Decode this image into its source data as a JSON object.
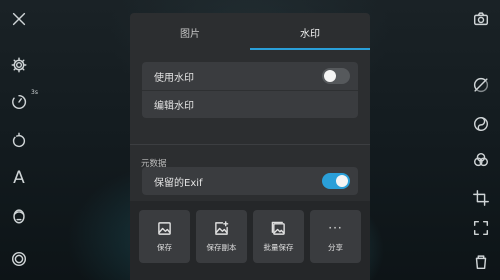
{
  "left_toolbar": {
    "items": [
      {
        "icon": "close-icon"
      },
      {
        "icon": "gear-icon"
      },
      {
        "icon": "timer-icon",
        "badge": "3s"
      },
      {
        "icon": "rotate-icon"
      },
      {
        "icon": "text-icon",
        "glyph": "A"
      },
      {
        "icon": "face-icon"
      },
      {
        "icon": "shutter-icon"
      }
    ]
  },
  "right_toolbar": {
    "items": [
      {
        "icon": "camera-icon"
      },
      {
        "icon": "filter-off-icon"
      },
      {
        "icon": "swirl-icon"
      },
      {
        "icon": "color-circles-icon"
      },
      {
        "icon": "crop-icon"
      },
      {
        "icon": "frame-icon"
      },
      {
        "icon": "bucket-icon"
      }
    ]
  },
  "sheet": {
    "tabs": [
      {
        "label": "图片",
        "active": false
      },
      {
        "label": "水印",
        "active": true
      }
    ],
    "watermark_group": {
      "use_watermark": {
        "label": "使用水印",
        "toggle_on": false
      },
      "edit_watermark": {
        "label": "编辑水印"
      }
    },
    "metadata_section_label": "元数据",
    "keep_exif": {
      "label": "保留的Exif",
      "toggle_on": true
    },
    "actions": [
      {
        "label": "保存",
        "icon": "image-icon"
      },
      {
        "label": "保存副本",
        "icon": "image-plus-icon"
      },
      {
        "label": "批量保存",
        "icon": "images-stack-icon"
      },
      {
        "label": "分享",
        "icon": "more-dots-icon",
        "glyph": "···"
      }
    ]
  },
  "colors": {
    "accent": "#2a9fd8",
    "sheet_bg": "#2c2e30",
    "group_bg": "#3a3c3f"
  }
}
